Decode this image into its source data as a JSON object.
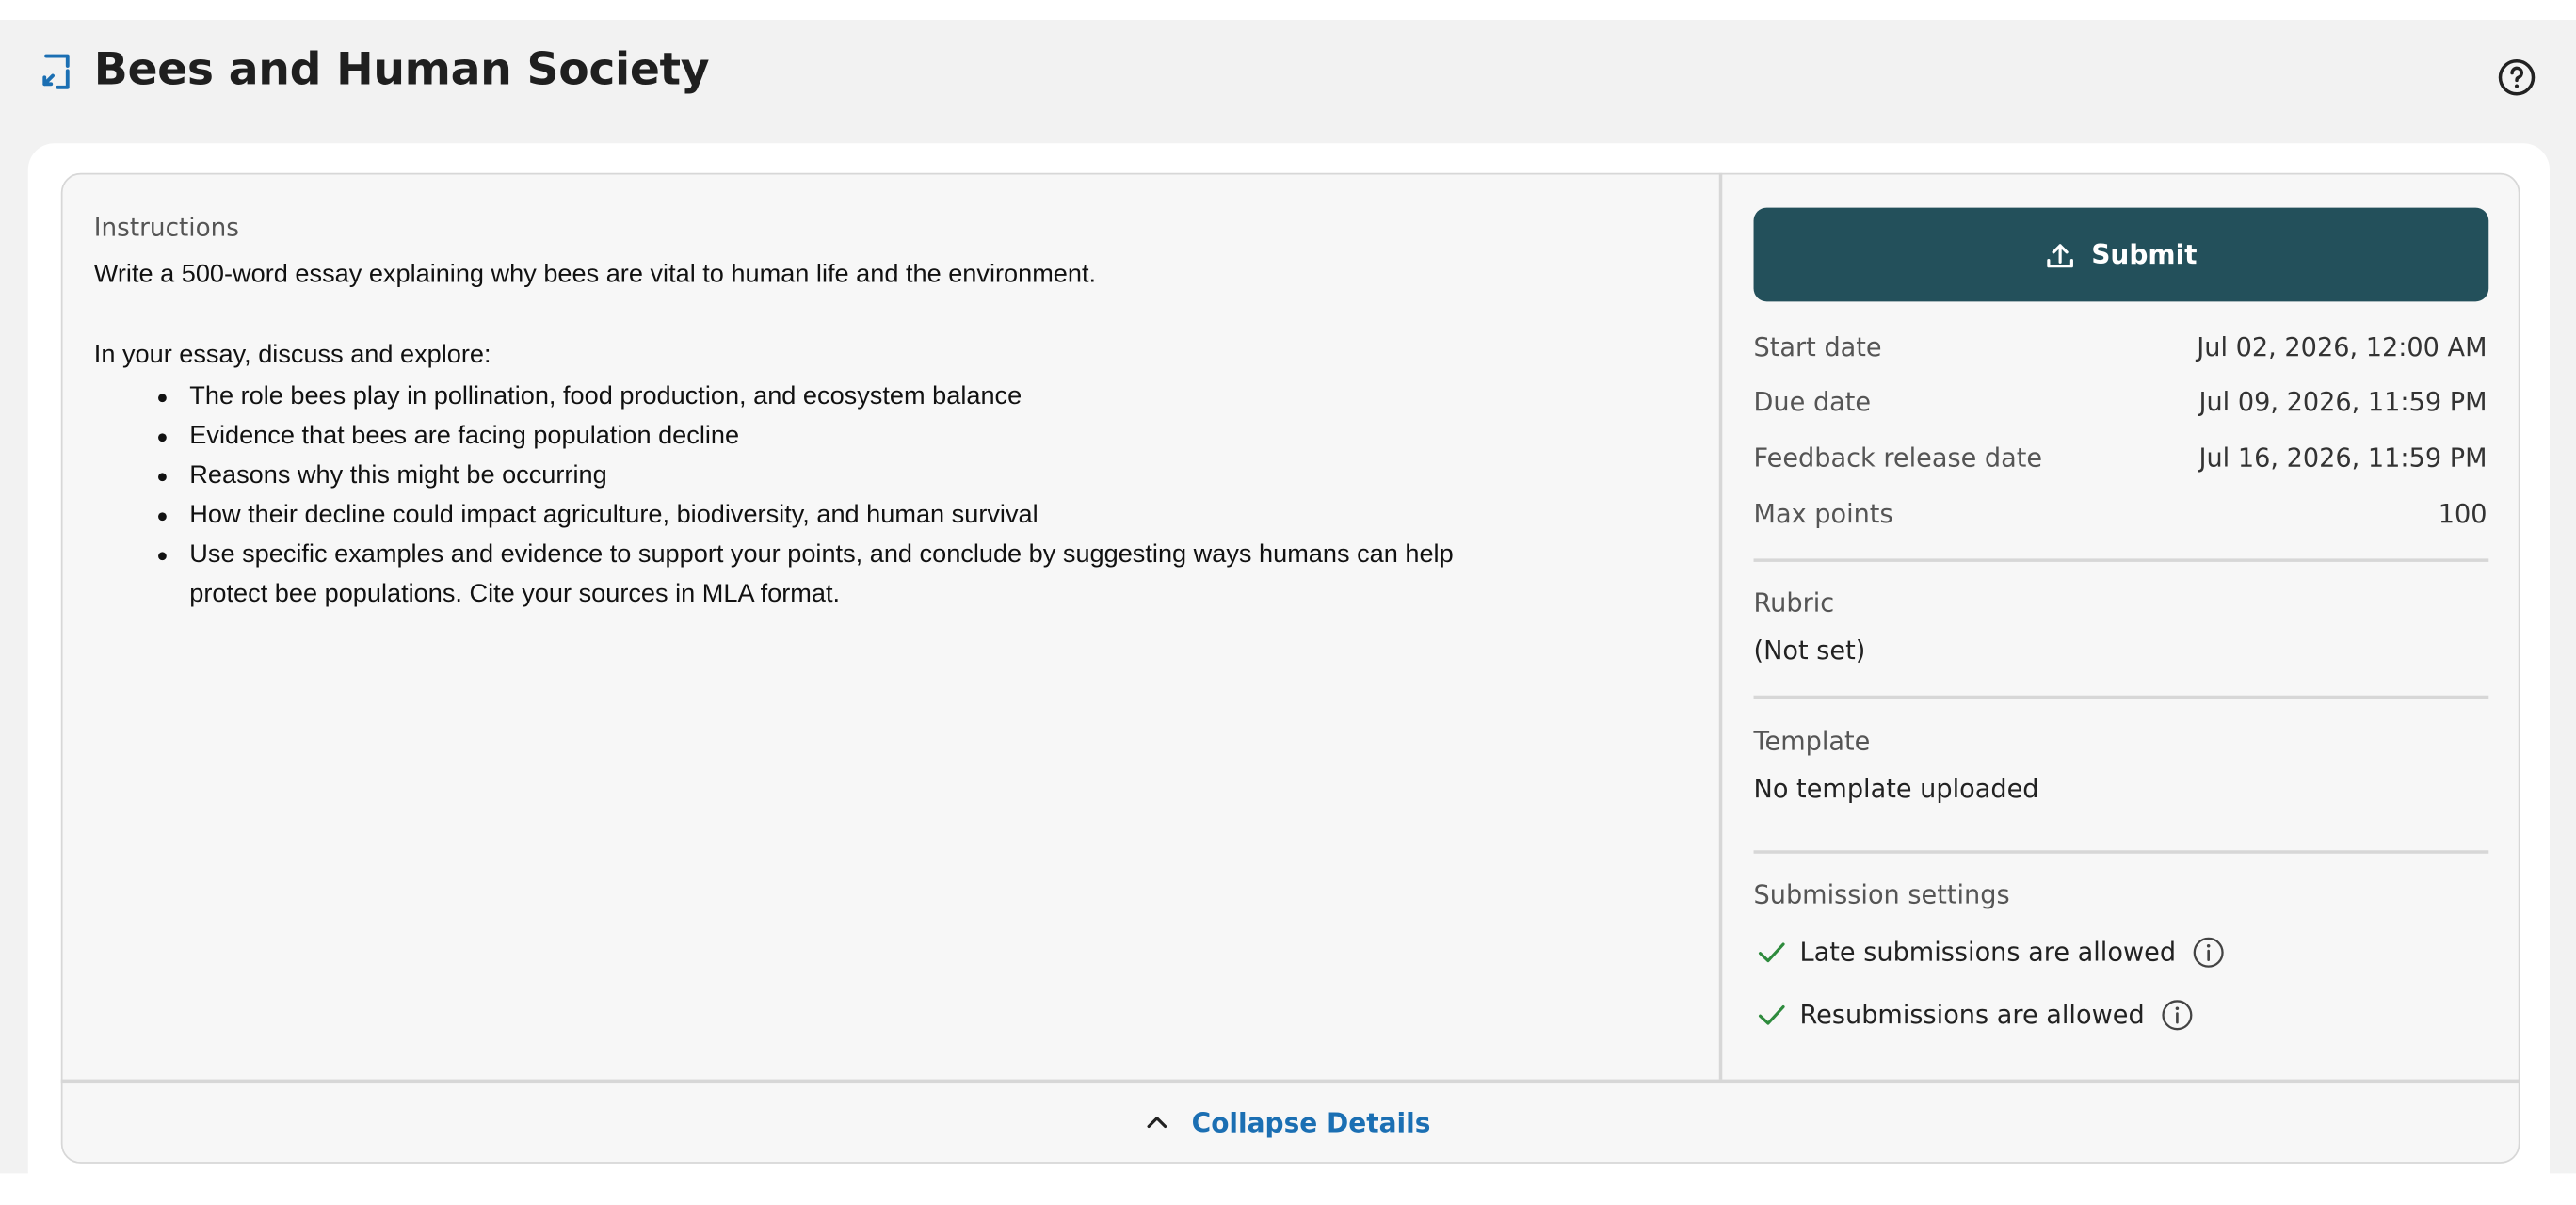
{
  "header": {
    "title": "Bees and Human Society",
    "icon": "assignment-link-icon",
    "help_icon": "help-circle-icon"
  },
  "instructions": {
    "label": "Instructions",
    "intro": "Write a 500-word essay explaining why bees are vital to human life and the environment.",
    "discuss_heading": "In your essay, discuss and explore:",
    "bullets": [
      "The role bees play in pollination, food production, and ecosystem balance",
      "Evidence that bees are facing population decline",
      "Reasons why this might be occurring",
      "How their decline could impact agriculture, biodiversity, and human survival",
      "Use specific examples and evidence to support your points, and conclude by suggesting ways humans can help"
    ],
    "bullet_continuation": "protect bee populations. Cite your sources in MLA format."
  },
  "sidebar": {
    "submit_label": "Submit",
    "submit_icon": "upload-icon",
    "meta": [
      {
        "label": "Start date",
        "value": "Jul 02, 2026, 12:00 AM"
      },
      {
        "label": "Due date",
        "value": "Jul 09, 2026, 11:59 PM"
      },
      {
        "label": "Feedback release date",
        "value": "Jul 16, 2026, 11:59 PM"
      },
      {
        "label": "Max points",
        "value": "100"
      }
    ],
    "rubric": {
      "label": "Rubric",
      "value": "(Not set)"
    },
    "template": {
      "label": "Template",
      "value": "No template uploaded"
    },
    "submission_settings": {
      "label": "Submission settings",
      "items": [
        {
          "text": "Late submissions are allowed",
          "icon": "check-icon",
          "info_icon": "info-icon"
        },
        {
          "text": "Resubmissions are allowed",
          "icon": "check-icon",
          "info_icon": "info-icon"
        }
      ]
    }
  },
  "footer": {
    "collapse_label": "Collapse Details",
    "collapse_icon": "chevron-up-icon"
  },
  "colors": {
    "submit_bg": "#23505b",
    "link_blue": "#1b6fb3",
    "check_green": "#2e8b3d",
    "page_bg": "#f2f2f2"
  }
}
